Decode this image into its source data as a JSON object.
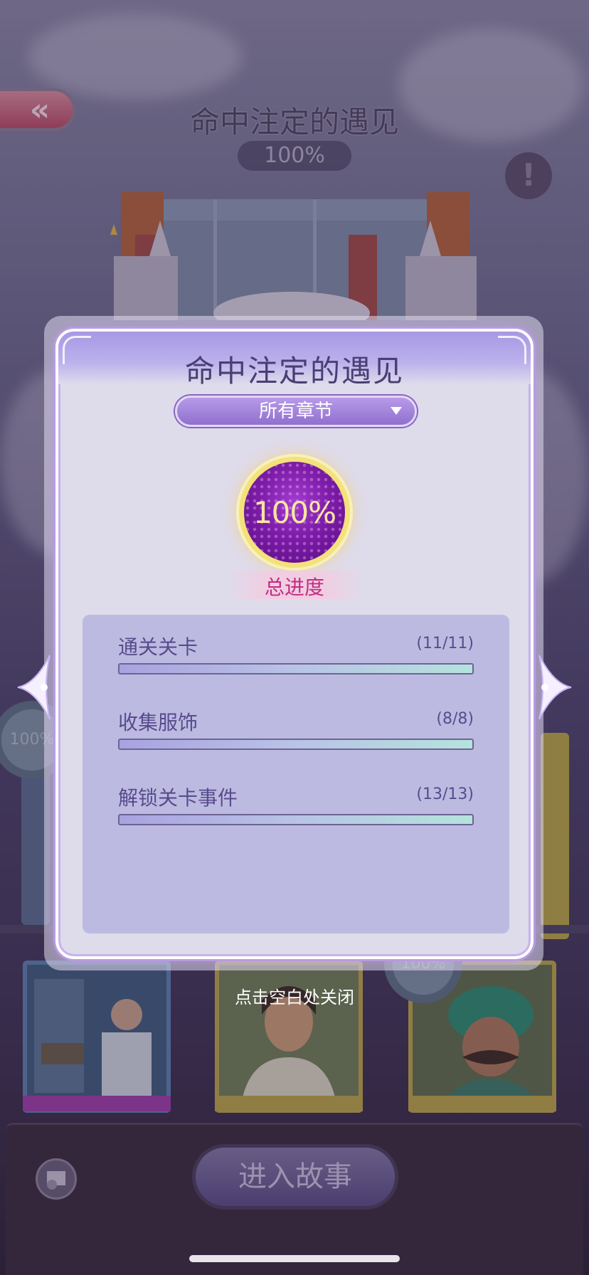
{
  "background": {
    "story_title": "命中注定的遇见",
    "story_progress": "100%",
    "info_icon": "exclamation-icon",
    "back_icon": "double-chevron-left-icon",
    "card_badges": [
      "100%",
      "100%"
    ],
    "enter_button_label": "进入故事",
    "settings_icon": "book-gear-icon"
  },
  "modal": {
    "title": "命中注定的遇见",
    "chapter_select": "所有章节",
    "overall_progress": "100%",
    "overall_label": "总进度",
    "stats": [
      {
        "label": "通关关卡",
        "count": "(11/11)",
        "fraction": 1.0
      },
      {
        "label": "收集服饰",
        "count": "(8/8)",
        "fraction": 1.0
      },
      {
        "label": "解锁关卡事件",
        "count": "(13/13)",
        "fraction": 1.0
      }
    ],
    "prev_icon": "arrow-left-icon",
    "next_icon": "arrow-right-icon"
  },
  "close_hint": "点击空白处关闭",
  "colors": {
    "accent_purple": "#9070cf",
    "progress_gold": "#f3e27a",
    "label_pink": "#c02d84",
    "text_dark": "#584c8c"
  }
}
